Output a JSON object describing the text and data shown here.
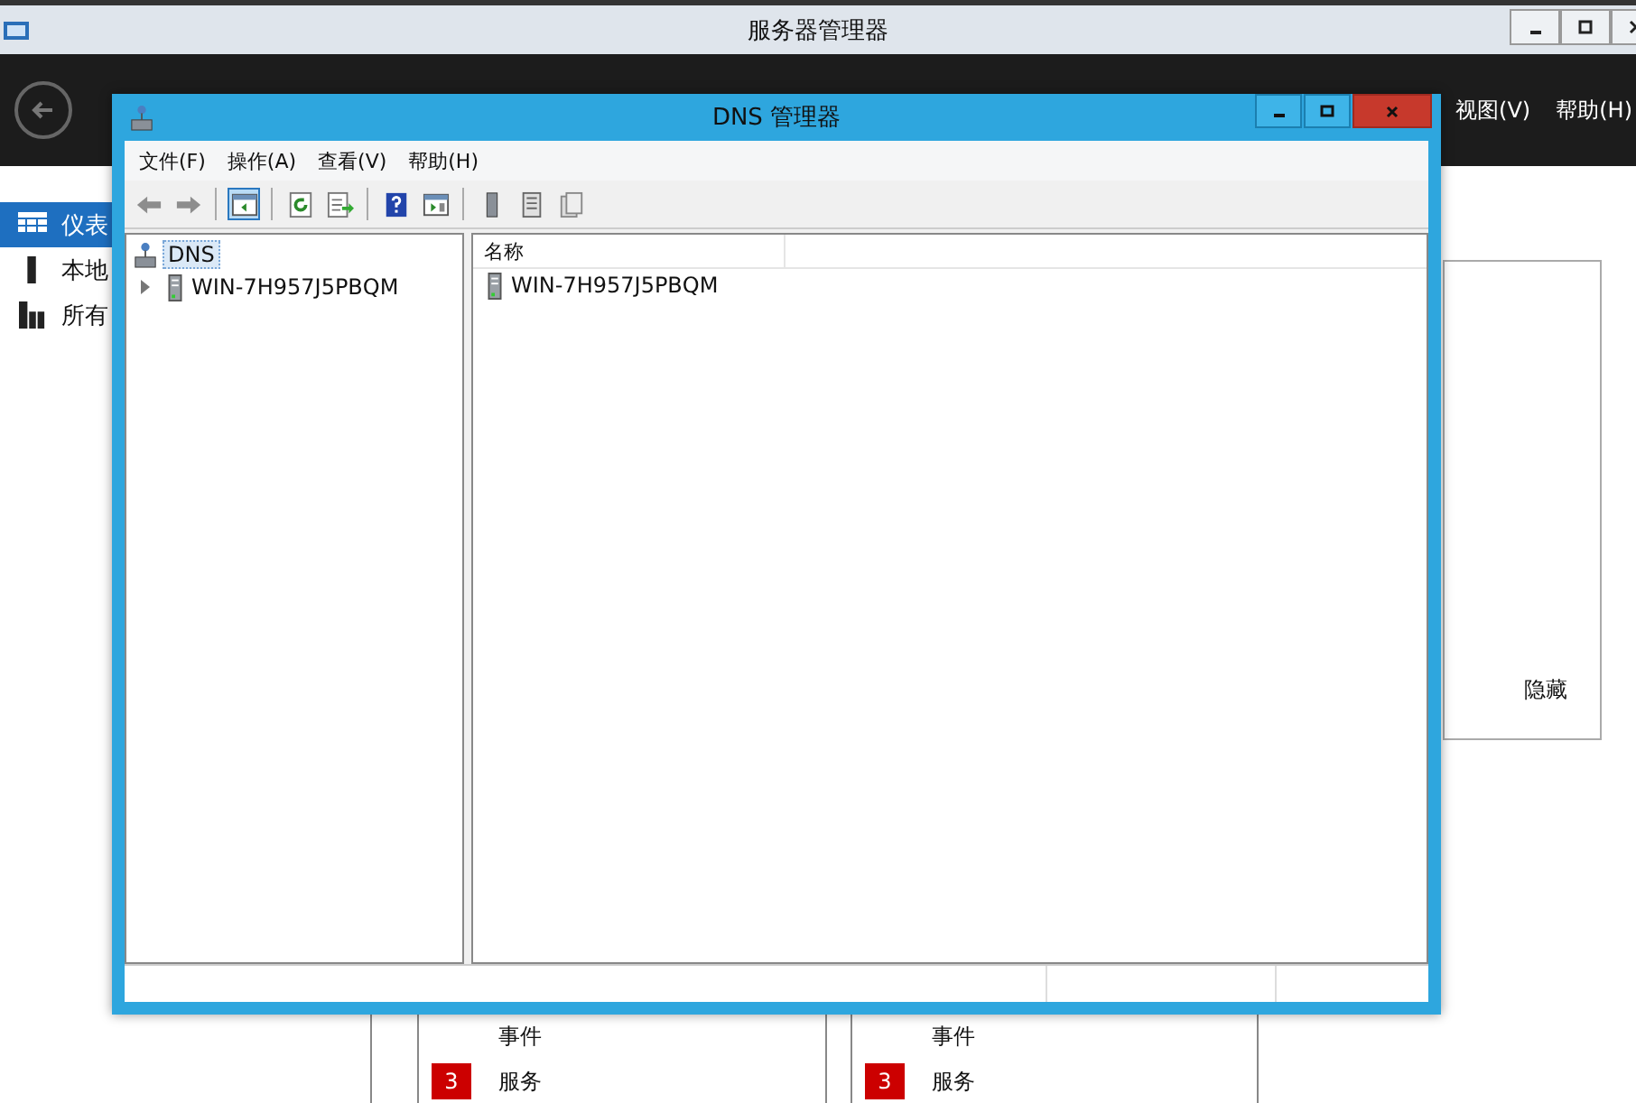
{
  "background_window": {
    "title": "服务器管理器",
    "menu": [
      "视图(V)",
      "帮助(H)"
    ],
    "sidebar": [
      {
        "label": "仪表",
        "kind": "dashboard",
        "selected": true
      },
      {
        "label": "本地",
        "kind": "server",
        "selected": false
      },
      {
        "label": "所有",
        "kind": "servers",
        "selected": false
      }
    ],
    "hide_label": "隐藏",
    "tiles": [
      {
        "heading": "事件",
        "badge": "3",
        "label": "服务"
      },
      {
        "heading": "事件",
        "badge": "3",
        "label": "服务"
      }
    ]
  },
  "dns_window": {
    "title": "DNS 管理器",
    "menu": [
      "文件(F)",
      "操作(A)",
      "查看(V)",
      "帮助(H)"
    ],
    "toolbar": [
      {
        "kind": "back",
        "pressed": false
      },
      {
        "kind": "forward",
        "pressed": false
      },
      {
        "kind": "separator"
      },
      {
        "kind": "tree",
        "pressed": true
      },
      {
        "kind": "separator"
      },
      {
        "kind": "refresh",
        "pressed": false
      },
      {
        "kind": "export",
        "pressed": false
      },
      {
        "kind": "separator"
      },
      {
        "kind": "help",
        "pressed": false
      },
      {
        "kind": "panel",
        "pressed": false
      },
      {
        "kind": "separator"
      },
      {
        "kind": "server",
        "pressed": false
      },
      {
        "kind": "list",
        "pressed": false
      },
      {
        "kind": "copy",
        "pressed": false
      }
    ],
    "tree": [
      {
        "label": "DNS",
        "selected": true,
        "children": [
          {
            "label": "WIN-7H957J5PBQM",
            "selected": false,
            "expanded": false
          }
        ]
      }
    ],
    "list": {
      "columns": [
        "名称"
      ],
      "rows": [
        "WIN-7H957J5PBQM"
      ]
    }
  }
}
